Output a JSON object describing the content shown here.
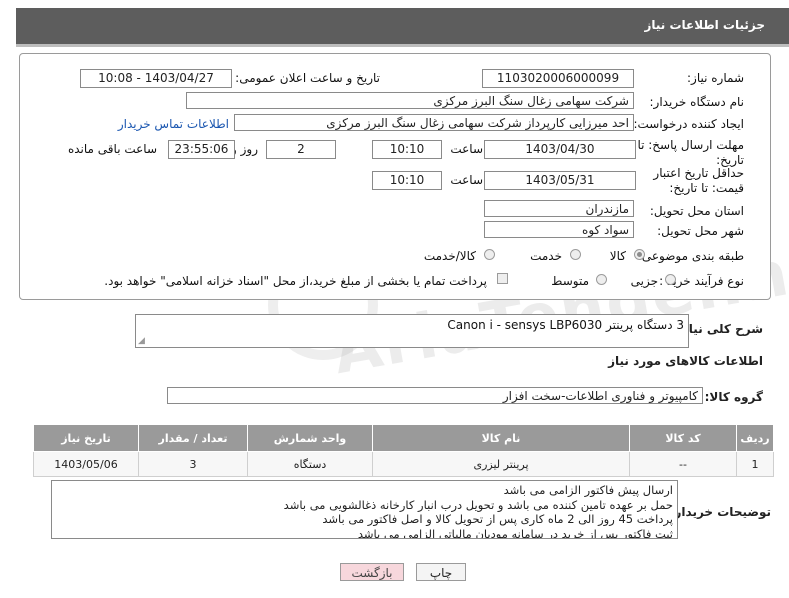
{
  "header": {
    "title": "جزئیات اطلاعات نیاز"
  },
  "fields": {
    "need_number_label": "شماره نیاز:",
    "need_number": "1103020006000099",
    "announce_label": "تاریخ و ساعت اعلان عمومی:",
    "announce_value": "1403/04/27 - 10:08",
    "buyer_label": "نام دستگاه خریدار:",
    "buyer_value": "شرکت سهامی زغال سنگ البرز مرکزی",
    "creator_label": "ایجاد کننده درخواست:",
    "creator_value": "احد میرزایی کارپرداز شرکت سهامی زغال سنگ البرز مرکزی",
    "contact_link": "اطلاعات تماس خریدار",
    "deadline_label": "مهلت ارسال پاسخ: تا تاریخ:",
    "deadline_date": "1403/04/30",
    "time_label": "ساعت",
    "deadline_time": "10:10",
    "days": "2",
    "day_and_label": "روز و",
    "remaining_time": "23:55:06",
    "remaining_label": "ساعت باقی مانده",
    "validity_label": "حداقل تاریخ اعتبار قیمت: تا تاریخ:",
    "validity_date": "1403/05/31",
    "validity_time": "10:10",
    "province_label": "استان محل تحویل:",
    "province_value": "مازندران",
    "city_label": "شهر محل تحویل:",
    "city_value": "سواد کوه",
    "category_label": "طبقه بندی موضوعی:",
    "category_options": [
      "کالا",
      "خدمت",
      "کالا/خدمت"
    ],
    "category_selected": "کالا",
    "process_label": "نوع فرآیند خرید :",
    "process_options": [
      "جزیی",
      "متوسط"
    ],
    "payment_note": "پرداخت تمام یا بخشی از مبلغ خرید،از محل \"اسناد خزانه اسلامی\" خواهد بود."
  },
  "description": {
    "label": "شرح کلی نیاز:",
    "value": "3 دستگاه پرینتر  Canon i - sensys LBP6030"
  },
  "goods_info": {
    "title": "اطلاعات کالاهای مورد نیاز",
    "group_label": "گروه کالا:",
    "group_value": "کامپیوتر و فناوری اطلاعات-سخت افزار"
  },
  "table": {
    "headers": [
      "ردیف",
      "کد کالا",
      "نام کالا",
      "واحد شمارش",
      "تعداد / مقدار",
      "تاریخ نیاز"
    ],
    "rows": [
      [
        "1",
        "--",
        "پرینتر لیزری",
        "دستگاه",
        "3",
        "1403/05/06"
      ]
    ]
  },
  "buyer_notes": {
    "label": "توضیحات خریدار:",
    "lines": [
      "ارسال پیش فاکتور الزامی می باشد",
      "حمل بر عهده تامین کننده می باشد و تحویل درب انبار کارخانه ذغالشویی می باشد",
      "پرداخت 45 روز الی 2 ماه کاری پس از تحویل کالا و اصل فاکتور می باشد",
      "ثبت فاکتور پس از خرید در سامانه مودیان مالیاتی الزامی می باشد"
    ]
  },
  "buttons": {
    "print": "چاپ",
    "back": "بازگشت"
  },
  "watermark": "AriaTender.neT",
  "colors": {
    "titlebar": "#5d5d5d",
    "link": "#1a56b0",
    "table_header": "#9a9a9a",
    "back_button": "#f7d7dc"
  }
}
